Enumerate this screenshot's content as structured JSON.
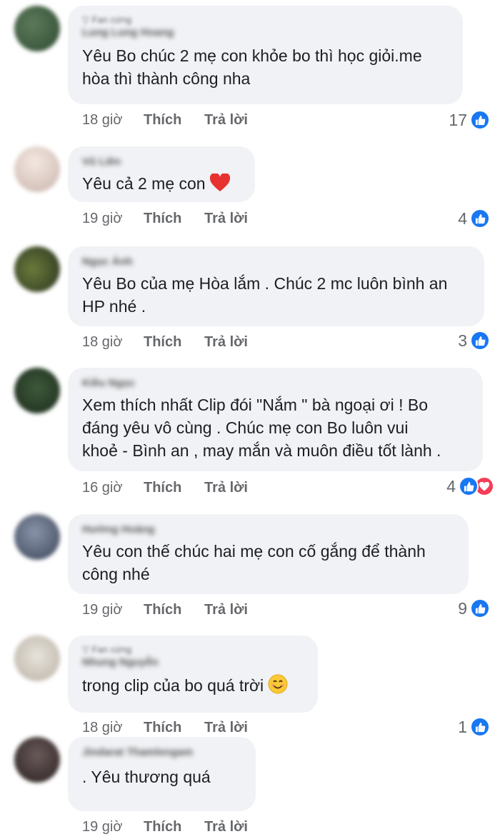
{
  "comments": [
    {
      "badge": "Fan cứng",
      "author": "Lung Lung Hoang",
      "text": "Yêu Bo chúc 2 mẹ con khỏe bo thì học giỏi.me\nhòa thì thành công nha",
      "time": "18 giờ",
      "like_label": "Thích",
      "reply_label": "Trả lời",
      "reactions": "17",
      "reaction_icons": [
        "like-icon"
      ]
    },
    {
      "author": "Vũ Liên",
      "text": "Yêu cả 2 mẹ con",
      "emoji": "red-heart-emoji",
      "time": "19 giờ",
      "like_label": "Thích",
      "reply_label": "Trả lời",
      "reactions": "4",
      "reaction_icons": [
        "like-icon"
      ]
    },
    {
      "author": "Ngọc Ánh",
      "text": "Yêu Bo của mẹ Hòa lắm . Chúc 2 mc luôn bình an\nHP nhé .",
      "time": "18 giờ",
      "like_label": "Thích",
      "reply_label": "Trả lời",
      "reactions": "3",
      "reaction_icons": [
        "like-icon"
      ]
    },
    {
      "author": "Kiều Ngọc",
      "text": "Xem thích nhất Clip đói \"Nắm \" bà ngoại ơi ! Bo\nđáng yêu vô cùng . Chúc mẹ con Bo luôn vui\nkhoẻ - Bình an , may mắn và muôn điều tốt lành .",
      "time": "16 giờ",
      "like_label": "Thích",
      "reply_label": "Trả lời",
      "reactions": "4",
      "reaction_icons": [
        "like-icon",
        "love-icon"
      ]
    },
    {
      "author": "Hường Hoàng",
      "text": "Yêu con thế chúc hai mẹ con cố gắng để thành\ncông nhé",
      "time": "19 giờ",
      "like_label": "Thích",
      "reply_label": "Trả lời",
      "reactions": "9",
      "reaction_icons": [
        "like-icon"
      ]
    },
    {
      "badge": "Fan cứng",
      "author": "Nhung Nguyễn",
      "text": "trong clip của bo quá trời",
      "emoji": "smiling-face-emoji",
      "time": "18 giờ",
      "like_label": "Thích",
      "reply_label": "Trả lời",
      "reactions": "1",
      "reaction_icons": [
        "like-icon"
      ]
    },
    {
      "author": "Jindarat Thamlengam",
      "text": ".  Yêu thương quá",
      "time": "19 giờ",
      "like_label": "Thích",
      "reply_label": "Trả lời",
      "reactions": "",
      "reaction_icons": []
    }
  ],
  "colors": {
    "bubble": "#f0f2f5",
    "like_blue": "#1877f2",
    "love_red": "#f33e58",
    "meta_gray": "#65676b"
  }
}
